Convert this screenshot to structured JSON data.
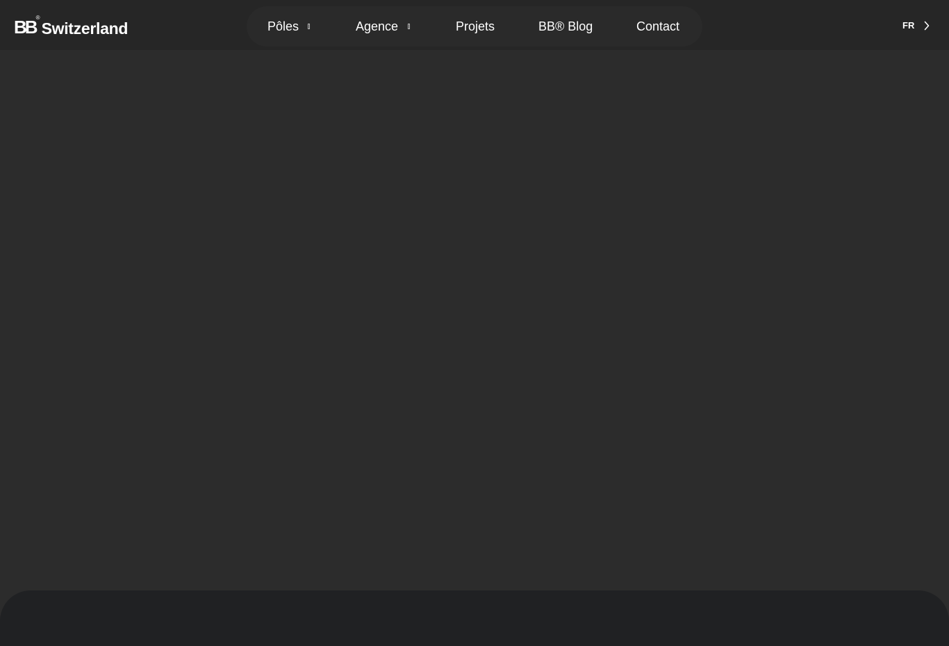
{
  "header": {
    "logo": {
      "mark": "BB",
      "registered": "®",
      "name": "Switzerland"
    },
    "nav": [
      {
        "label": "Pôles",
        "has_dropdown": true
      },
      {
        "label": "Agence",
        "has_dropdown": true
      },
      {
        "label": "Projets",
        "has_dropdown": false
      },
      {
        "label": "BB® Blog",
        "has_dropdown": false
      },
      {
        "label": "Contact",
        "has_dropdown": false
      }
    ],
    "language": {
      "label": "FR",
      "icon": "chevron-right-icon"
    }
  },
  "colors": {
    "header_bg": "#262626",
    "page_bg": "#2c2c2c",
    "nav_pill_bg": "#2a2a2a",
    "bottom_panel_bg": "#202123",
    "text": "#ffffff"
  }
}
